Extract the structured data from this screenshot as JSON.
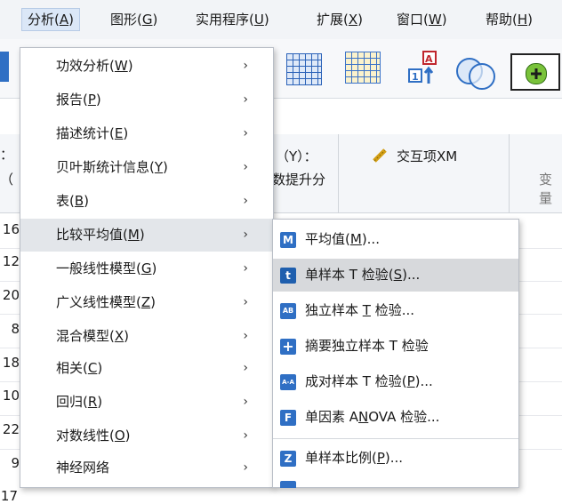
{
  "menubar": {
    "items": [
      {
        "label": "分析(",
        "key": "A",
        "tail": ")"
      },
      {
        "label": "图形(",
        "key": "G",
        "tail": ")"
      },
      {
        "label": "实用程序(",
        "key": "U",
        "tail": ")"
      },
      {
        "label": "扩展(",
        "key": "X",
        "tail": ")"
      },
      {
        "label": "窗口(",
        "key": "W",
        "tail": ")"
      },
      {
        "label": "帮助(",
        "key": "H",
        "tail": ")"
      }
    ]
  },
  "sheet": {
    "headers": {
      "col1_line1": "：",
      "col1_line2": "（",
      "col2_line1": "（Y）：",
      "col2_line2": "数提升分",
      "col3": "交互项XM",
      "col4": "变量"
    },
    "row_numbers": [
      "16",
      "12",
      "20",
      "8",
      "18",
      "10",
      "22",
      "9",
      "17"
    ]
  },
  "analyze_menu": {
    "items": [
      {
        "pre": "功效分析(",
        "key": "W",
        "post": ")"
      },
      {
        "pre": "报告(",
        "key": "P",
        "post": ")"
      },
      {
        "pre": "描述统计(",
        "key": "E",
        "post": ")"
      },
      {
        "pre": "贝叶斯统计信息(",
        "key": "Y",
        "post": ")"
      },
      {
        "pre": "表(",
        "key": "B",
        "post": ")"
      },
      {
        "pre": "比较平均值(",
        "key": "M",
        "post": ")"
      },
      {
        "pre": "一般线性模型(",
        "key": "G",
        "post": ")"
      },
      {
        "pre": "广义线性模型(",
        "key": "Z",
        "post": ")"
      },
      {
        "pre": "混合模型(",
        "key": "X",
        "post": ")"
      },
      {
        "pre": "相关(",
        "key": "C",
        "post": ")"
      },
      {
        "pre": "回归(",
        "key": "R",
        "post": ")"
      },
      {
        "pre": "对数线性(",
        "key": "O",
        "post": ")"
      },
      {
        "pre": "神经网络",
        "key": "",
        "post": ""
      }
    ],
    "arrow": "›"
  },
  "compare_means_submenu": {
    "items": [
      {
        "icon": "M",
        "pre": "平均值(",
        "key": "M",
        "post": ")..."
      },
      {
        "icon": "t",
        "pre": "单样本 T 检验(",
        "key": "S",
        "post": ")..."
      },
      {
        "icon": "AB",
        "pre": "独立样本 ",
        "key": "T",
        "post": " 检验..."
      },
      {
        "icon": "+",
        "pre": "摘要独立样本 T 检验",
        "key": "",
        "post": ""
      },
      {
        "icon": "A-A",
        "pre": "成对样本 T 检验(",
        "key": "P",
        "post": ")..."
      },
      {
        "icon": "F",
        "pre": "单因素 A",
        "key": "N",
        "post": "OVA 检验..."
      },
      {
        "icon": "Z",
        "pre": "单样本比例(",
        "key": "P",
        "post": ")..."
      }
    ]
  },
  "colors": {
    "menu_highlight": "#e3e6ea",
    "icon_blue": "#2f6fc4"
  }
}
